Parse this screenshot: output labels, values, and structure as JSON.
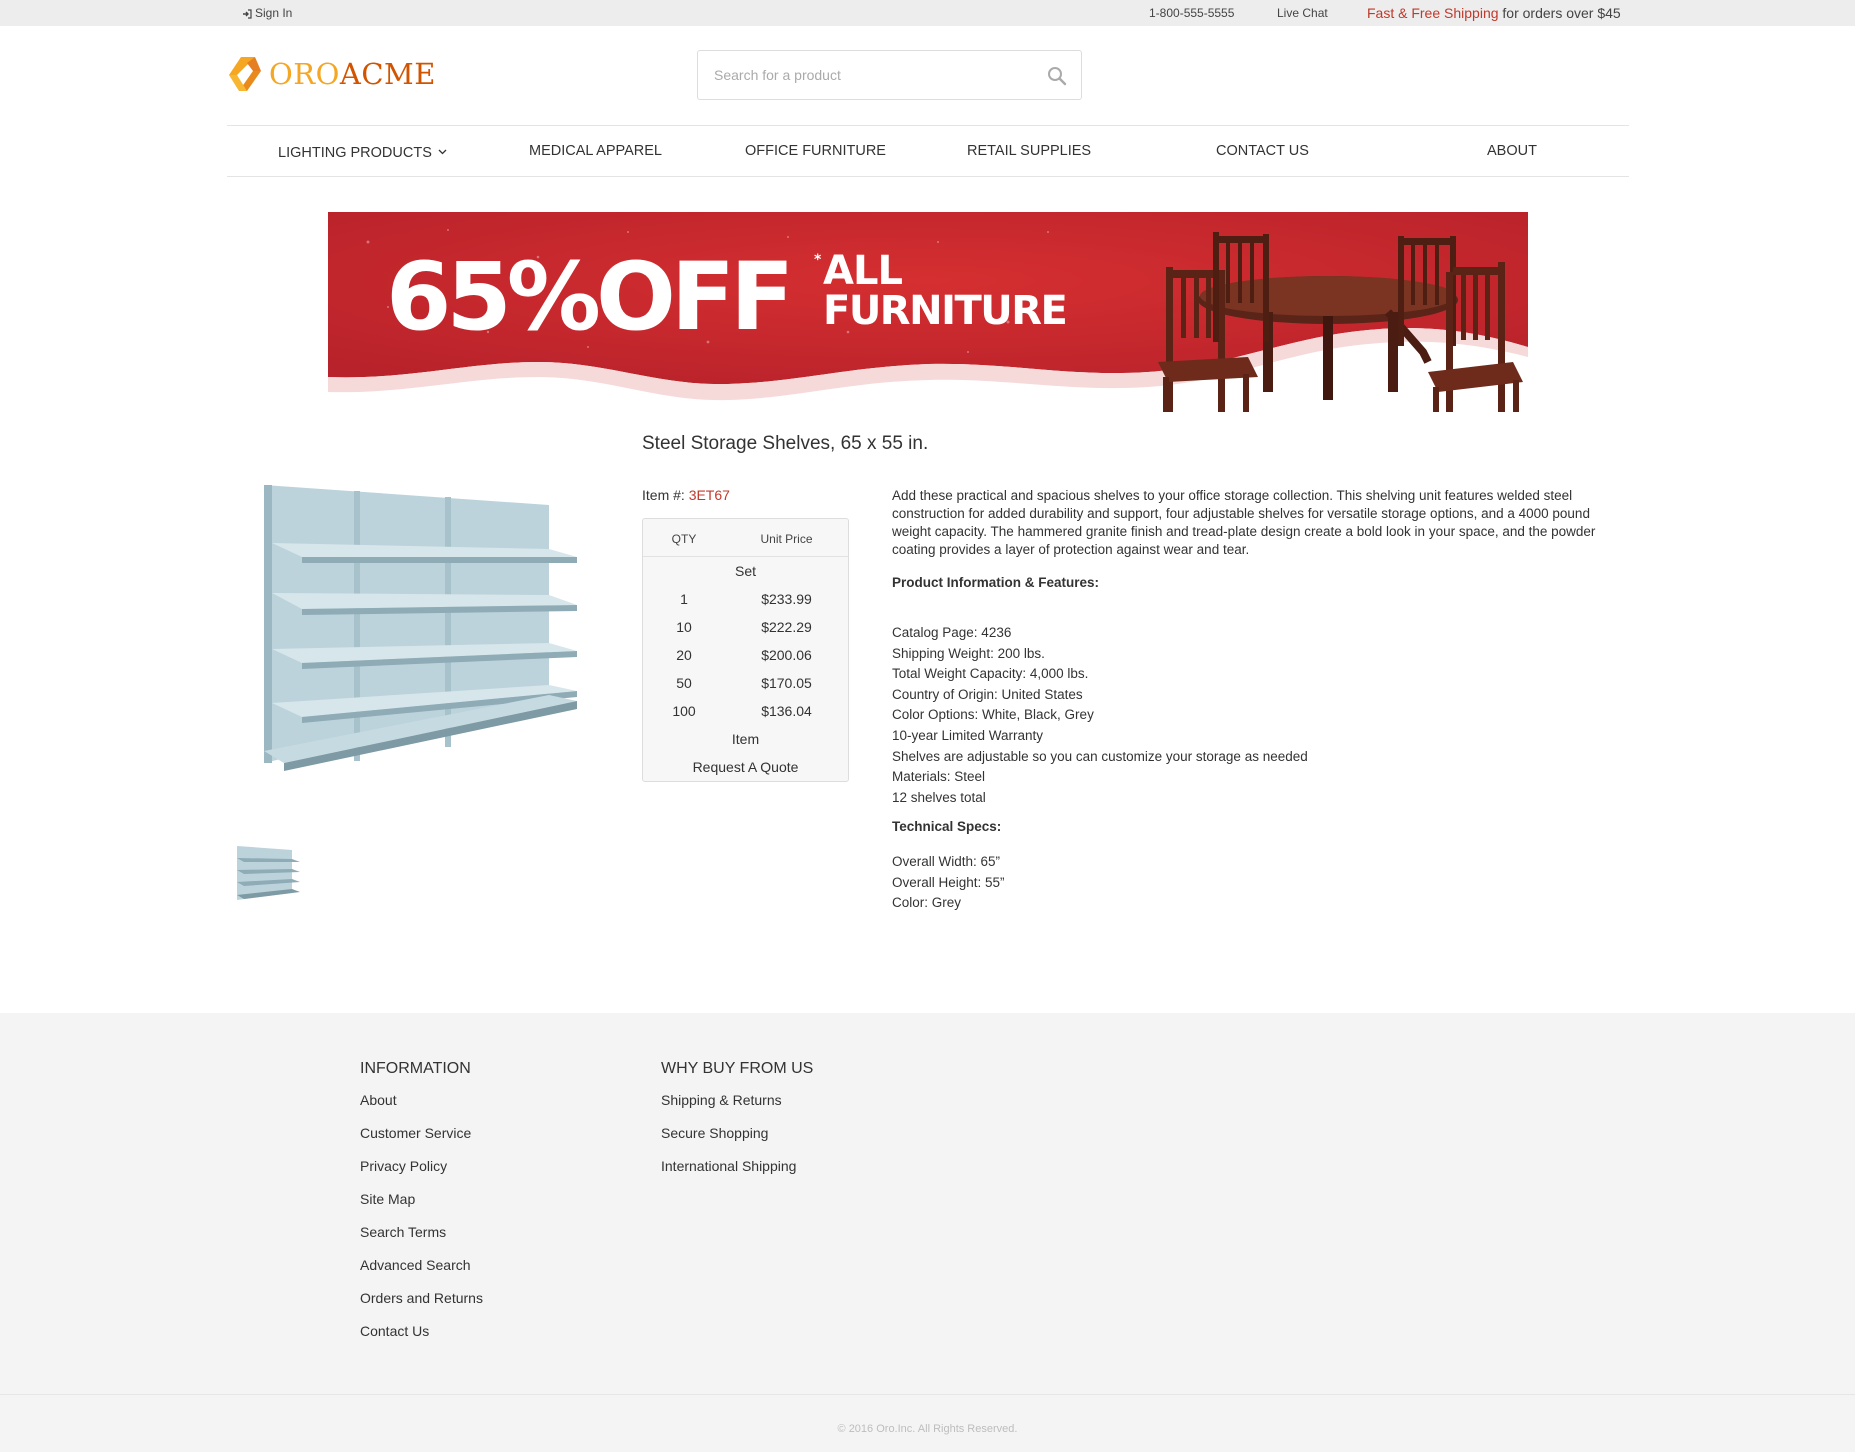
{
  "topbar": {
    "sign_in": "Sign In",
    "phone": "1-800-555-5555",
    "live_chat": "Live Chat",
    "promo_highlight": "Fast & Free Shipping",
    "promo_rest": " for orders over $45"
  },
  "logo": {
    "part1": "ORO",
    "part2": "ACME"
  },
  "search": {
    "placeholder": "Search for a product"
  },
  "nav": {
    "items": [
      {
        "label": "Lighting Products"
      },
      {
        "label": "Medical Apparel"
      },
      {
        "label": "Office Furniture"
      },
      {
        "label": "Retail Supplies"
      },
      {
        "label": "Contact Us"
      },
      {
        "label": "About"
      }
    ]
  },
  "banner": {
    "headline": "65%OFF",
    "asterisk": "*",
    "line1": "ALL",
    "line2": "FURNITURE"
  },
  "product": {
    "title": "Steel Storage Shelves, 65 x 55 in.",
    "item_label": "Item #: ",
    "sku": "3ET67",
    "price_table": {
      "col_qty": "QTY",
      "col_price": "Unit Price",
      "group_set": "Set",
      "rows": [
        {
          "qty": "1",
          "price": "$233.99"
        },
        {
          "qty": "10",
          "price": "$222.29"
        },
        {
          "qty": "20",
          "price": "$200.06"
        },
        {
          "qty": "50",
          "price": "$170.05"
        },
        {
          "qty": "100",
          "price": "$136.04"
        }
      ],
      "group_item": "Item",
      "quote": "Request A Quote"
    },
    "description": "Add these practical and spacious shelves to your office storage collection. This shelving unit features welded steel construction for added durability and support, four adjustable shelves for versatile storage options, and a 4000 pound weight capacity. The hammered granite finish and tread-plate design create a bold look in your space, and the powder coating provides a layer of protection against wear and tear.",
    "features_heading": "Product Information & Features:",
    "features": [
      "Catalog Page: 4236",
      "Shipping Weight: 200 lbs.",
      "Total Weight Capacity: 4,000 lbs.",
      "Country of Origin: United States",
      "Color Options: White, Black, Grey",
      "10-year Limited Warranty",
      "Shelves are adjustable so you can customize your storage as needed",
      "Materials: Steel",
      "12 shelves total"
    ],
    "tech_heading": "Technical Specs:",
    "tech": [
      "Overall Width: 65”",
      "Overall Height: 55”",
      "Color: Grey"
    ]
  },
  "footer": {
    "col1": {
      "title": "Information",
      "links": [
        "About",
        "Customer Service",
        "Privacy Policy",
        "Site Map",
        "Search Terms",
        "Advanced Search",
        "Orders and Returns",
        "Contact Us"
      ]
    },
    "col2": {
      "title": "Why buy from us",
      "links": [
        "Shipping & Returns",
        "Secure Shopping",
        "International Shipping"
      ]
    },
    "copyright": "© 2016 Oro.Inc. All Rights Reserved."
  },
  "colors": {
    "accent": "#c0392b",
    "banner_red": "#c8282c",
    "logo_orange": "#f5a623",
    "logo_dark_orange": "#d35400"
  }
}
